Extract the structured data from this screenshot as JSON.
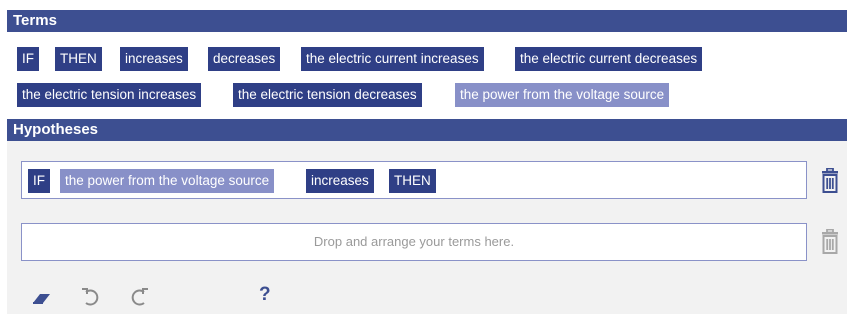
{
  "terms": {
    "header": "Terms",
    "chips": [
      "IF",
      "THEN",
      "increases",
      "decreases",
      "the electric current increases",
      "the electric current decreases",
      "the electric tension increases",
      "the electric tension decreases",
      "the power from the voltage source"
    ]
  },
  "hypotheses": {
    "header": "Hypotheses",
    "rows": [
      {
        "chips": [
          "IF",
          "the power from the voltage source",
          "increases",
          "THEN"
        ]
      }
    ],
    "drop_placeholder": "Drop and arrange your terms here."
  },
  "toolbar": {
    "help_label": "?"
  },
  "icons": [
    "eraser-icon",
    "undo-icon",
    "redo-icon",
    "trash-icon"
  ],
  "colors": {
    "primary": "#3d4f91",
    "chip": "#2f3f86",
    "chip_used": "#8890c8",
    "background_panel": "#f2f2f2"
  }
}
